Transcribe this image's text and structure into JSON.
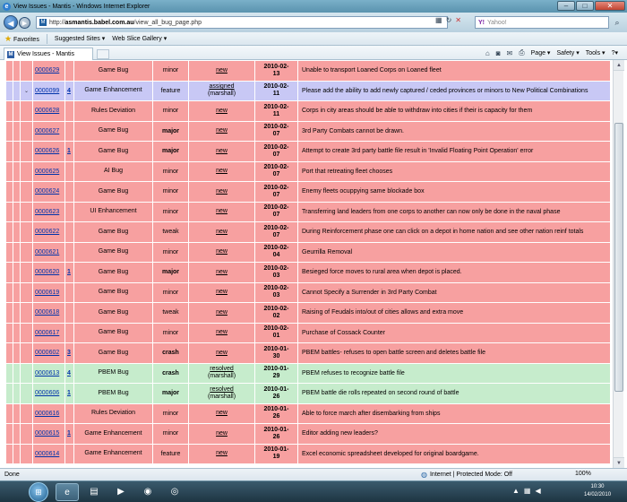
{
  "window": {
    "title": "View Issues - Mantis - Windows Internet Explorer",
    "buttons": {
      "minimize": "–",
      "maximize": "□",
      "close": "✕"
    }
  },
  "address_bar": {
    "url_prefix": "http://",
    "url_domain": "asmantis.babel.com.au",
    "url_path": "/view_all_bug_page.php",
    "search_provider": "Yahoo!",
    "search_placeholder": "Yahoo!"
  },
  "favorites_bar": {
    "favorites_label": "Favorites",
    "suggested_sites": "Suggested Sites ▾",
    "web_slice_gallery": "Web Slice Gallery ▾"
  },
  "tab": {
    "label": "View Issues - Mantis"
  },
  "command_bar": {
    "page": "Page ▾",
    "safety": "Safety ▾",
    "tools": "Tools ▾",
    "help": "?▾"
  },
  "issues": [
    {
      "id": "0000629",
      "notes": "",
      "category": "Game Bug",
      "severity": "minor",
      "status": "new",
      "status_by": "",
      "date_line1": "2010-02-",
      "date_line2": "13",
      "summary": "Unable to transport Loaned Corps on Loaned fleet",
      "row_state": "new",
      "severity_bold": false,
      "selected": false
    },
    {
      "id": "0000099",
      "notes": "4",
      "category": "Game Enhancement",
      "severity": "feature",
      "status": "assigned",
      "status_by": "(marshall)",
      "date_line1": "2010-02-",
      "date_line2": "11",
      "summary": "Please add the ability to add newly captured / ceded provinces or minors to New Political Combinations",
      "row_state": "assigned",
      "severity_bold": false,
      "selected": true
    },
    {
      "id": "0000628",
      "notes": "",
      "category": "Rules Deviation",
      "severity": "minor",
      "status": "new",
      "status_by": "",
      "date_line1": "2010-02-",
      "date_line2": "11",
      "summary": "Corps in city areas should be able to withdraw into cities if their is capacity for them",
      "row_state": "new",
      "severity_bold": false,
      "selected": false
    },
    {
      "id": "0000627",
      "notes": "",
      "category": "Game Bug",
      "severity": "major",
      "status": "new",
      "status_by": "",
      "date_line1": "2010-02-",
      "date_line2": "07",
      "summary": "3rd Party Combats cannot be drawn.",
      "row_state": "new",
      "severity_bold": true,
      "selected": false
    },
    {
      "id": "0000626",
      "notes": "1",
      "category": "Game Bug",
      "severity": "major",
      "status": "new",
      "status_by": "",
      "date_line1": "2010-02-",
      "date_line2": "07",
      "summary": "Attempt to create 3rd party battle file result in 'Invalid Floating Point Operation' error",
      "row_state": "new",
      "severity_bold": true,
      "selected": false
    },
    {
      "id": "0000625",
      "notes": "",
      "category": "AI Bug",
      "severity": "minor",
      "status": "new",
      "status_by": "",
      "date_line1": "2010-02-",
      "date_line2": "07",
      "summary": "Port that retreating fleet chooses",
      "row_state": "new",
      "severity_bold": false,
      "selected": false
    },
    {
      "id": "0000624",
      "notes": "",
      "category": "Game Bug",
      "severity": "minor",
      "status": "new",
      "status_by": "",
      "date_line1": "2010-02-",
      "date_line2": "07",
      "summary": "Enemy fleets ocuppying same blockade box",
      "row_state": "new",
      "severity_bold": false,
      "selected": false
    },
    {
      "id": "0000623",
      "notes": "",
      "category": "UI Enhancement",
      "severity": "minor",
      "status": "new",
      "status_by": "",
      "date_line1": "2010-02-",
      "date_line2": "07",
      "summary": "Transferring land leaders from one corps to another can now only be done in the naval phase",
      "row_state": "new",
      "severity_bold": false,
      "selected": false
    },
    {
      "id": "0000622",
      "notes": "",
      "category": "Game Bug",
      "severity": "tweak",
      "status": "new",
      "status_by": "",
      "date_line1": "2010-02-",
      "date_line2": "07",
      "summary": "During Reinforcement phase one can click on a depot in home nation and see other nation reinf totals",
      "row_state": "new",
      "severity_bold": false,
      "selected": false
    },
    {
      "id": "0000621",
      "notes": "",
      "category": "Game Bug",
      "severity": "minor",
      "status": "new",
      "status_by": "",
      "date_line1": "2010-02-",
      "date_line2": "04",
      "summary": "Geurrilla Removal",
      "row_state": "new",
      "severity_bold": false,
      "selected": false
    },
    {
      "id": "0000620",
      "notes": "1",
      "category": "Game Bug",
      "severity": "major",
      "status": "new",
      "status_by": "",
      "date_line1": "2010-02-",
      "date_line2": "03",
      "summary": "Besieged force moves to rural area when depot is placed.",
      "row_state": "new",
      "severity_bold": true,
      "selected": false
    },
    {
      "id": "0000619",
      "notes": "",
      "category": "Game Bug",
      "severity": "minor",
      "status": "new",
      "status_by": "",
      "date_line1": "2010-02-",
      "date_line2": "03",
      "summary": "Cannot Specify a Surrender in 3rd Party Combat",
      "row_state": "new",
      "severity_bold": false,
      "selected": false
    },
    {
      "id": "0000618",
      "notes": "",
      "category": "Game Bug",
      "severity": "tweak",
      "status": "new",
      "status_by": "",
      "date_line1": "2010-02-",
      "date_line2": "02",
      "summary": "Raising of Feudals into/out of cities allows and extra move",
      "row_state": "new",
      "severity_bold": false,
      "selected": false
    },
    {
      "id": "0000617",
      "notes": "",
      "category": "Game Bug",
      "severity": "minor",
      "status": "new",
      "status_by": "",
      "date_line1": "2010-02-",
      "date_line2": "01",
      "summary": "Purchase of Cossack Counter",
      "row_state": "new",
      "severity_bold": false,
      "selected": false
    },
    {
      "id": "0000602",
      "notes": "3",
      "category": "Game Bug",
      "severity": "crash",
      "status": "new",
      "status_by": "",
      "date_line1": "2010-01-",
      "date_line2": "30",
      "summary": "PBEM battles- refuses to open battle screen and deletes battle file",
      "row_state": "new",
      "severity_bold": true,
      "selected": false
    },
    {
      "id": "0000613",
      "notes": "4",
      "category": "PBEM Bug",
      "severity": "crash",
      "status": "resolved",
      "status_by": "(marshall)",
      "date_line1": "2010-01-",
      "date_line2": "29",
      "summary": "PBEM refuses to recognize battle file",
      "row_state": "resolved",
      "severity_bold": true,
      "selected": false
    },
    {
      "id": "0000606",
      "notes": "1",
      "category": "PBEM Bug",
      "severity": "major",
      "status": "resolved",
      "status_by": "(marshall)",
      "date_line1": "2010-01-",
      "date_line2": "26",
      "summary": "PBEM battle die rolls repeated on second round of battle",
      "row_state": "resolved",
      "severity_bold": true,
      "selected": false
    },
    {
      "id": "0000616",
      "notes": "",
      "category": "Rules Deviation",
      "severity": "minor",
      "status": "new",
      "status_by": "",
      "date_line1": "2010-01-",
      "date_line2": "26",
      "summary": "Able to force march after disembarking from ships",
      "row_state": "new",
      "severity_bold": false,
      "selected": false
    },
    {
      "id": "0000615",
      "notes": "1",
      "category": "Game Enhancement",
      "severity": "minor",
      "status": "new",
      "status_by": "",
      "date_line1": "2010-01-",
      "date_line2": "26",
      "summary": "Editor adding new leaders?",
      "row_state": "new",
      "severity_bold": false,
      "selected": false
    },
    {
      "id": "0000614",
      "notes": "",
      "category": "Game Enhancement",
      "severity": "feature",
      "status": "new",
      "status_by": "",
      "date_line1": "2010-01-",
      "date_line2": "19",
      "summary": "Excel economic spreadsheet developed for original boardgame.",
      "row_state": "new",
      "severity_bold": false,
      "selected": false
    }
  ],
  "status_bar": {
    "left": "Done",
    "zone": "Internet | Protected Mode: Off",
    "zoom": "100%"
  },
  "taskbar": {
    "time": "10:30",
    "date": "14/02/2010"
  },
  "colors": {
    "row_new": "#f7a0a0",
    "row_assigned": "#c8c8f5",
    "row_resolved": "#c6eccc",
    "link": "#0033aa"
  }
}
